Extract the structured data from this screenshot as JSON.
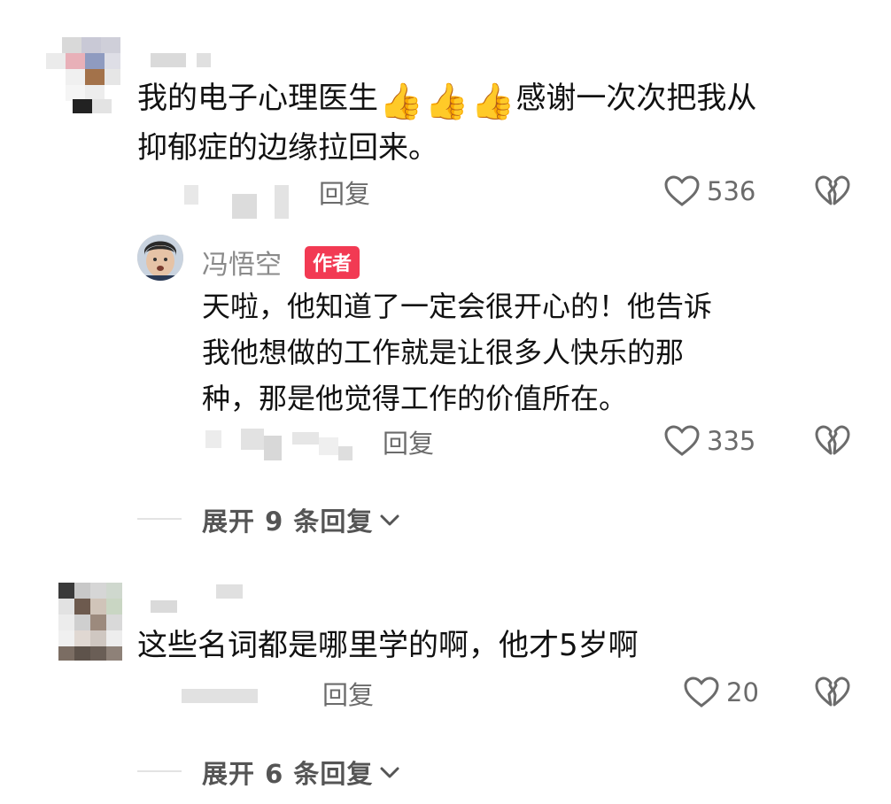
{
  "comments": [
    {
      "text_line1": "我的电子心理医生",
      "emoji": [
        "👍",
        "👍",
        "👍"
      ],
      "text_line1_after": "感谢一次次把我从",
      "text_line2": "抑郁症的边缘拉回来。",
      "reply_label": "回复",
      "likes": "536",
      "reply": {
        "author": "冯悟空",
        "badge": "作者",
        "lines": [
          "天啦，他知道了一定会很开心的！他告诉",
          "我他想做的工作就是让很多人快乐的那",
          "种，那是他觉得工作的价值所在。"
        ],
        "reply_label": "回复",
        "likes": "335"
      },
      "expand_label": "展开 9 条回复"
    },
    {
      "text": "这些名词都是哪里学的啊，他才5岁啊",
      "reply_label": "回复",
      "likes": "20",
      "expand_label": "展开 6 条回复"
    }
  ],
  "icons": {
    "like": "heart-outline-icon",
    "dislike": "broken-heart-icon",
    "expand": "chevron-down-icon"
  },
  "colors": {
    "badge": "#f23a53",
    "meta_text": "#6b6b6b",
    "body_text": "#111111"
  }
}
